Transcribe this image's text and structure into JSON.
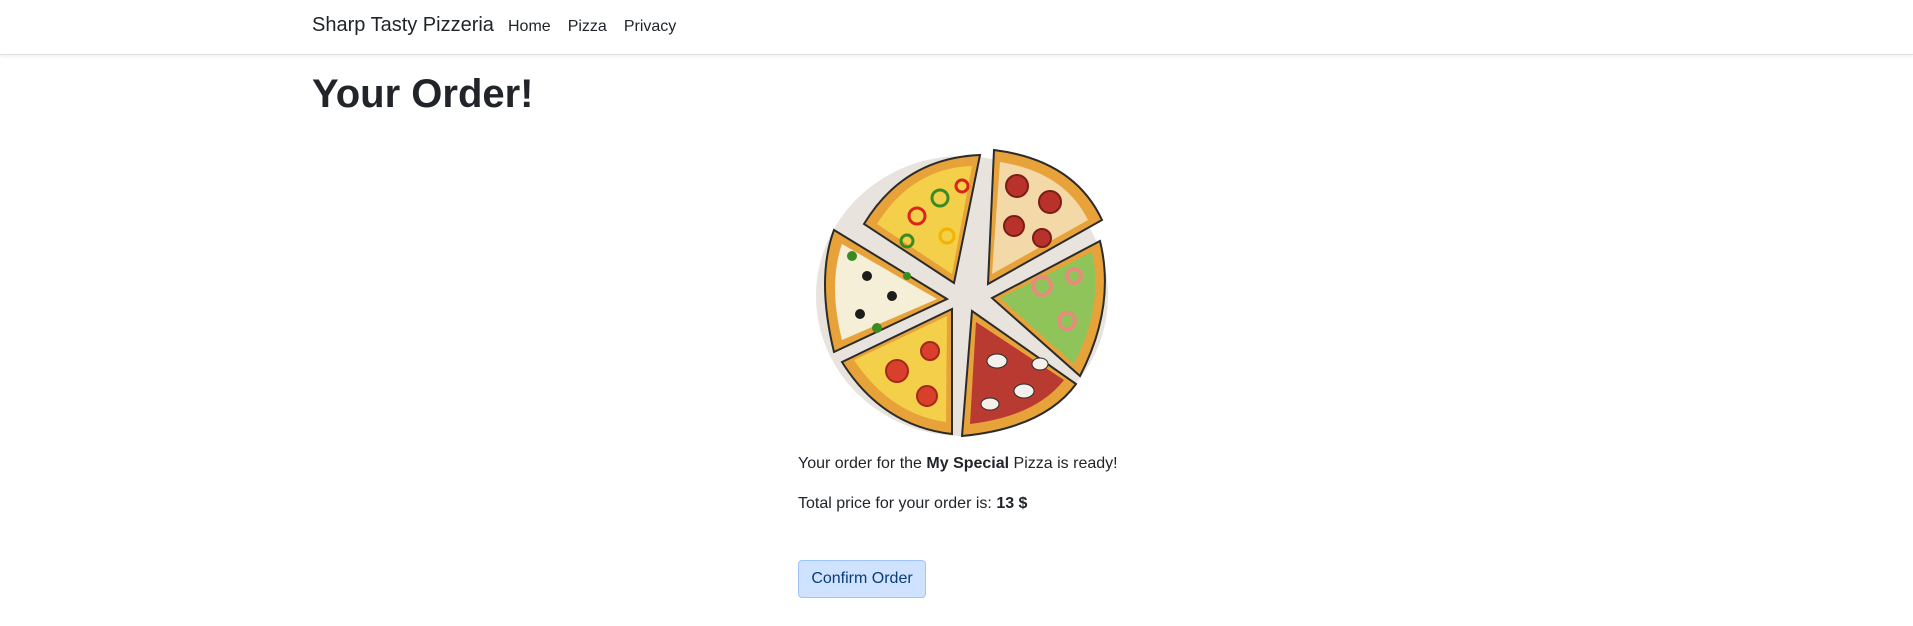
{
  "nav": {
    "brand": "Sharp Tasty Pizzeria",
    "links": [
      {
        "label": "Home"
      },
      {
        "label": "Pizza"
      },
      {
        "label": "Privacy"
      }
    ]
  },
  "main": {
    "title": "Your Order!",
    "order_prefix": "Your order for the",
    "pizza_name": "My Special",
    "order_suffix": "Pizza is ready!",
    "price_prefix": "Total price for your order is:",
    "price_value": "13 $",
    "confirm_label": "Confirm Order"
  },
  "image": {
    "icon": "pizza-image"
  },
  "colors": {
    "button_bg": "#cfe2ff",
    "button_border": "#9ec5fe",
    "button_text": "#0a3c78"
  }
}
